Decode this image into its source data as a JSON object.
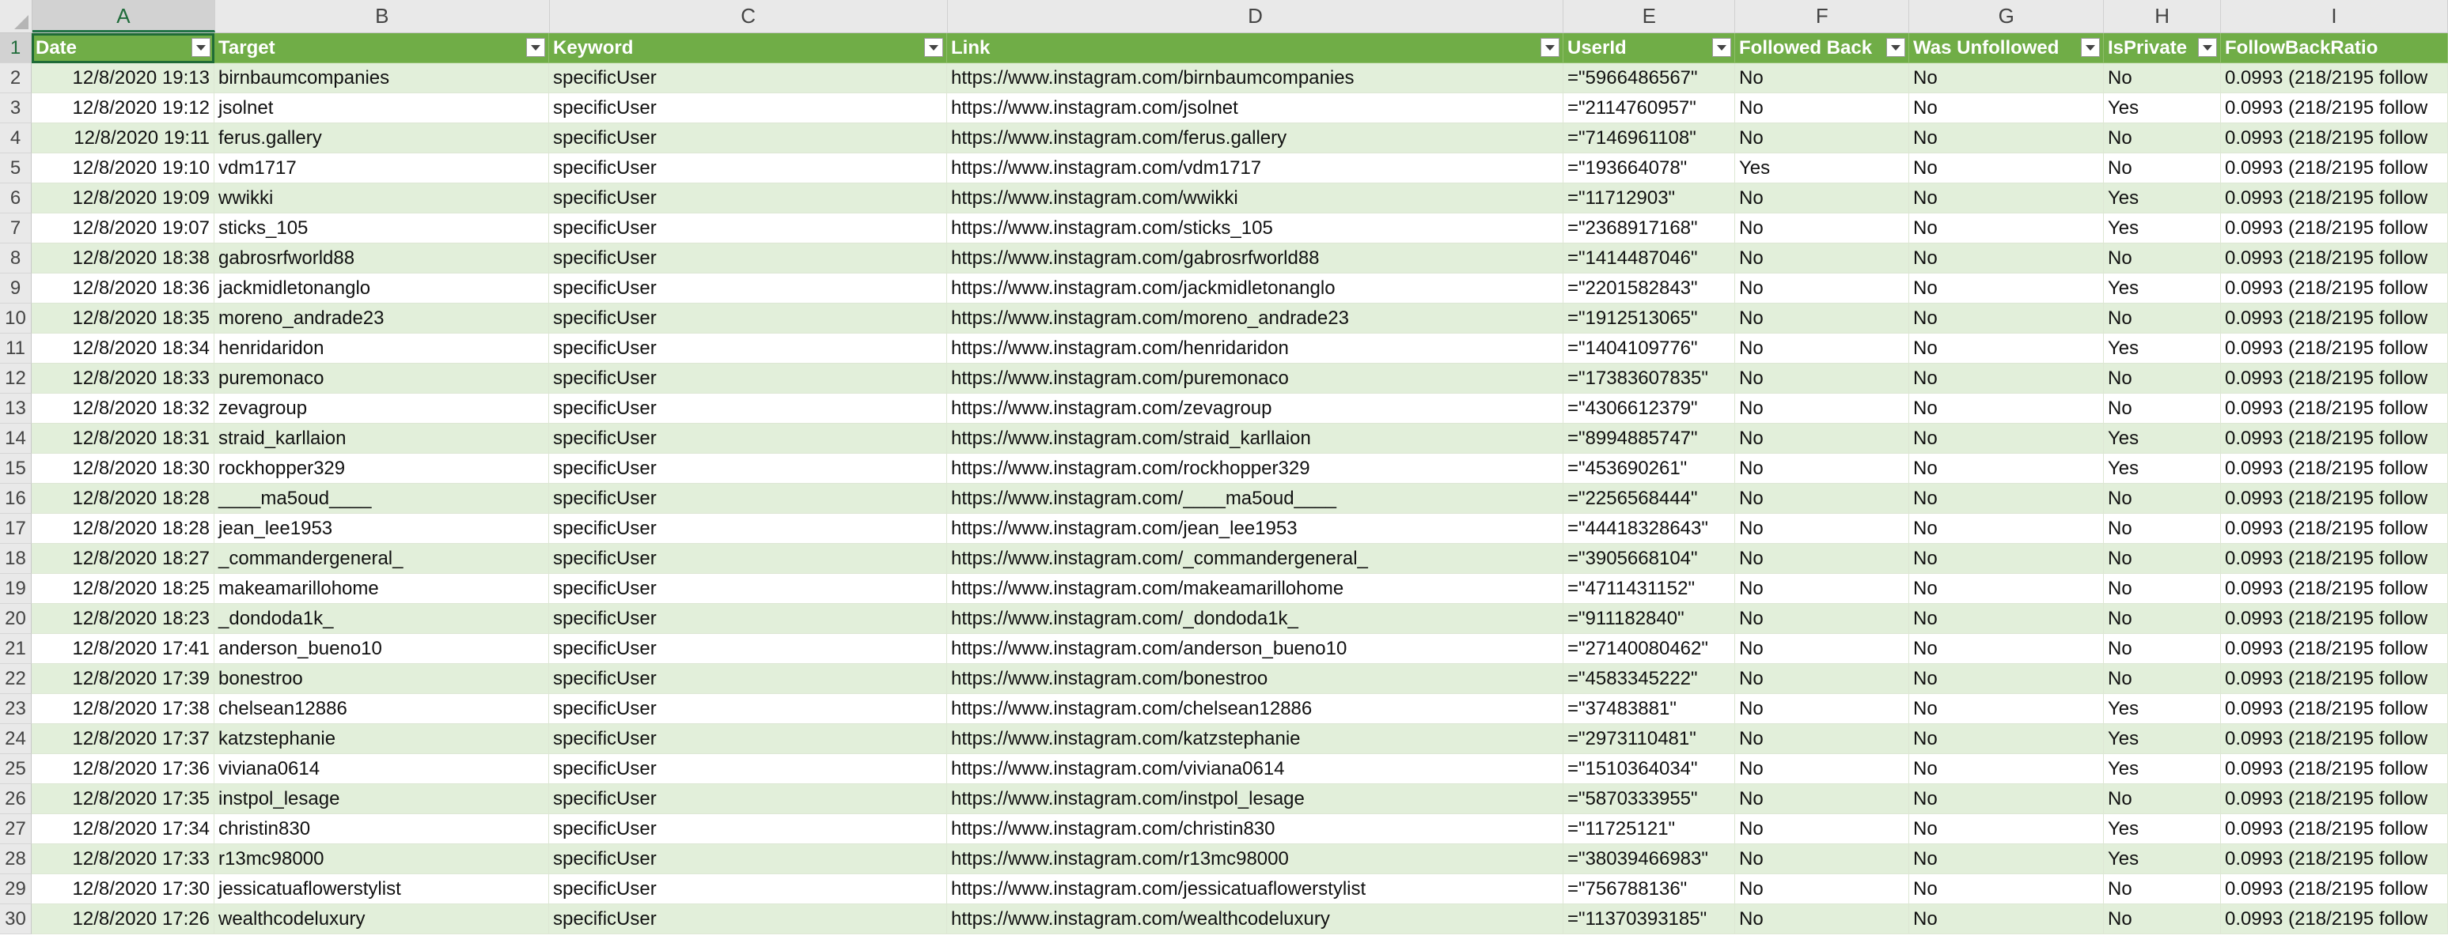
{
  "columns": [
    "A",
    "B",
    "C",
    "D",
    "E",
    "F",
    "G",
    "H",
    "I"
  ],
  "headers": [
    "Date",
    "Target",
    "Keyword",
    "Link",
    "UserId",
    "Followed Back",
    "Was Unfollowed",
    "IsPrivate",
    "FollowBackRatio"
  ],
  "rows": [
    {
      "num": "2",
      "date": "12/8/2020 19:13",
      "target": "birnbaumcompanies",
      "keyword": "specificUser",
      "link": "https://www.instagram.com/birnbaumcompanies",
      "userid": "=\"5966486567\"",
      "followed_back": "No",
      "was_unfollowed": "No",
      "is_private": "No",
      "ratio": "0.0993 (218/2195 follow"
    },
    {
      "num": "3",
      "date": "12/8/2020 19:12",
      "target": "jsolnet",
      "keyword": "specificUser",
      "link": "https://www.instagram.com/jsolnet",
      "userid": "=\"2114760957\"",
      "followed_back": "No",
      "was_unfollowed": "No",
      "is_private": "Yes",
      "ratio": "0.0993 (218/2195 follow"
    },
    {
      "num": "4",
      "date": "12/8/2020 19:11",
      "target": "ferus.gallery",
      "keyword": "specificUser",
      "link": "https://www.instagram.com/ferus.gallery",
      "userid": "=\"7146961108\"",
      "followed_back": "No",
      "was_unfollowed": "No",
      "is_private": "No",
      "ratio": "0.0993 (218/2195 follow"
    },
    {
      "num": "5",
      "date": "12/8/2020 19:10",
      "target": "vdm1717",
      "keyword": "specificUser",
      "link": "https://www.instagram.com/vdm1717",
      "userid": "=\"193664078\"",
      "followed_back": "Yes",
      "was_unfollowed": "No",
      "is_private": "No",
      "ratio": "0.0993 (218/2195 follow"
    },
    {
      "num": "6",
      "date": "12/8/2020 19:09",
      "target": "wwikki",
      "keyword": "specificUser",
      "link": "https://www.instagram.com/wwikki",
      "userid": "=\"11712903\"",
      "followed_back": "No",
      "was_unfollowed": "No",
      "is_private": "Yes",
      "ratio": "0.0993 (218/2195 follow"
    },
    {
      "num": "7",
      "date": "12/8/2020 19:07",
      "target": "sticks_105",
      "keyword": "specificUser",
      "link": "https://www.instagram.com/sticks_105",
      "userid": "=\"2368917168\"",
      "followed_back": "No",
      "was_unfollowed": "No",
      "is_private": "Yes",
      "ratio": "0.0993 (218/2195 follow"
    },
    {
      "num": "8",
      "date": "12/8/2020 18:38",
      "target": "gabrosrfworld88",
      "keyword": "specificUser",
      "link": "https://www.instagram.com/gabrosrfworld88",
      "userid": "=\"1414487046\"",
      "followed_back": "No",
      "was_unfollowed": "No",
      "is_private": "No",
      "ratio": "0.0993 (218/2195 follow"
    },
    {
      "num": "9",
      "date": "12/8/2020 18:36",
      "target": "jackmidletonanglo",
      "keyword": "specificUser",
      "link": "https://www.instagram.com/jackmidletonanglo",
      "userid": "=\"2201582843\"",
      "followed_back": "No",
      "was_unfollowed": "No",
      "is_private": "Yes",
      "ratio": "0.0993 (218/2195 follow"
    },
    {
      "num": "10",
      "date": "12/8/2020 18:35",
      "target": "moreno_andrade23",
      "keyword": "specificUser",
      "link": "https://www.instagram.com/moreno_andrade23",
      "userid": "=\"1912513065\"",
      "followed_back": "No",
      "was_unfollowed": "No",
      "is_private": "No",
      "ratio": "0.0993 (218/2195 follow"
    },
    {
      "num": "11",
      "date": "12/8/2020 18:34",
      "target": "henridaridon",
      "keyword": "specificUser",
      "link": "https://www.instagram.com/henridaridon",
      "userid": "=\"1404109776\"",
      "followed_back": "No",
      "was_unfollowed": "No",
      "is_private": "Yes",
      "ratio": "0.0993 (218/2195 follow"
    },
    {
      "num": "12",
      "date": "12/8/2020 18:33",
      "target": "puremonaco",
      "keyword": "specificUser",
      "link": "https://www.instagram.com/puremonaco",
      "userid": "=\"17383607835\"",
      "followed_back": "No",
      "was_unfollowed": "No",
      "is_private": "No",
      "ratio": "0.0993 (218/2195 follow"
    },
    {
      "num": "13",
      "date": "12/8/2020 18:32",
      "target": "zevagroup",
      "keyword": "specificUser",
      "link": "https://www.instagram.com/zevagroup",
      "userid": "=\"4306612379\"",
      "followed_back": "No",
      "was_unfollowed": "No",
      "is_private": "No",
      "ratio": "0.0993 (218/2195 follow"
    },
    {
      "num": "14",
      "date": "12/8/2020 18:31",
      "target": "straid_karllaion",
      "keyword": "specificUser",
      "link": "https://www.instagram.com/straid_karllaion",
      "userid": "=\"8994885747\"",
      "followed_back": "No",
      "was_unfollowed": "No",
      "is_private": "Yes",
      "ratio": "0.0993 (218/2195 follow"
    },
    {
      "num": "15",
      "date": "12/8/2020 18:30",
      "target": "rockhopper329",
      "keyword": "specificUser",
      "link": "https://www.instagram.com/rockhopper329",
      "userid": "=\"453690261\"",
      "followed_back": "No",
      "was_unfollowed": "No",
      "is_private": "Yes",
      "ratio": "0.0993 (218/2195 follow"
    },
    {
      "num": "16",
      "date": "12/8/2020 18:28",
      "target": "____ma5oud____",
      "keyword": "specificUser",
      "link": "https://www.instagram.com/____ma5oud____",
      "userid": "=\"2256568444\"",
      "followed_back": "No",
      "was_unfollowed": "No",
      "is_private": "No",
      "ratio": "0.0993 (218/2195 follow"
    },
    {
      "num": "17",
      "date": "12/8/2020 18:28",
      "target": "jean_lee1953",
      "keyword": "specificUser",
      "link": "https://www.instagram.com/jean_lee1953",
      "userid": "=\"44418328643\"",
      "followed_back": "No",
      "was_unfollowed": "No",
      "is_private": "No",
      "ratio": "0.0993 (218/2195 follow"
    },
    {
      "num": "18",
      "date": "12/8/2020 18:27",
      "target": "_commandergeneral_",
      "keyword": "specificUser",
      "link": "https://www.instagram.com/_commandergeneral_",
      "userid": "=\"3905668104\"",
      "followed_back": "No",
      "was_unfollowed": "No",
      "is_private": "No",
      "ratio": "0.0993 (218/2195 follow"
    },
    {
      "num": "19",
      "date": "12/8/2020 18:25",
      "target": "makeamarillohome",
      "keyword": "specificUser",
      "link": "https://www.instagram.com/makeamarillohome",
      "userid": "=\"4711431152\"",
      "followed_back": "No",
      "was_unfollowed": "No",
      "is_private": "No",
      "ratio": "0.0993 (218/2195 follow"
    },
    {
      "num": "20",
      "date": "12/8/2020 18:23",
      "target": "_dondoda1k_",
      "keyword": "specificUser",
      "link": "https://www.instagram.com/_dondoda1k_",
      "userid": "=\"911182840\"",
      "followed_back": "No",
      "was_unfollowed": "No",
      "is_private": "No",
      "ratio": "0.0993 (218/2195 follow"
    },
    {
      "num": "21",
      "date": "12/8/2020 17:41",
      "target": "anderson_bueno10",
      "keyword": "specificUser",
      "link": "https://www.instagram.com/anderson_bueno10",
      "userid": "=\"27140080462\"",
      "followed_back": "No",
      "was_unfollowed": "No",
      "is_private": "No",
      "ratio": "0.0993 (218/2195 follow"
    },
    {
      "num": "22",
      "date": "12/8/2020 17:39",
      "target": "bonestroo",
      "keyword": "specificUser",
      "link": "https://www.instagram.com/bonestroo",
      "userid": "=\"4583345222\"",
      "followed_back": "No",
      "was_unfollowed": "No",
      "is_private": "No",
      "ratio": "0.0993 (218/2195 follow"
    },
    {
      "num": "23",
      "date": "12/8/2020 17:38",
      "target": "chelsean12886",
      "keyword": "specificUser",
      "link": "https://www.instagram.com/chelsean12886",
      "userid": "=\"37483881\"",
      "followed_back": "No",
      "was_unfollowed": "No",
      "is_private": "Yes",
      "ratio": "0.0993 (218/2195 follow"
    },
    {
      "num": "24",
      "date": "12/8/2020 17:37",
      "target": "katzstephanie",
      "keyword": "specificUser",
      "link": "https://www.instagram.com/katzstephanie",
      "userid": "=\"2973110481\"",
      "followed_back": "No",
      "was_unfollowed": "No",
      "is_private": "Yes",
      "ratio": "0.0993 (218/2195 follow"
    },
    {
      "num": "25",
      "date": "12/8/2020 17:36",
      "target": "viviana0614",
      "keyword": "specificUser",
      "link": "https://www.instagram.com/viviana0614",
      "userid": "=\"1510364034\"",
      "followed_back": "No",
      "was_unfollowed": "No",
      "is_private": "Yes",
      "ratio": "0.0993 (218/2195 follow"
    },
    {
      "num": "26",
      "date": "12/8/2020 17:35",
      "target": "instpol_lesage",
      "keyword": "specificUser",
      "link": "https://www.instagram.com/instpol_lesage",
      "userid": "=\"5870333955\"",
      "followed_back": "No",
      "was_unfollowed": "No",
      "is_private": "No",
      "ratio": "0.0993 (218/2195 follow"
    },
    {
      "num": "27",
      "date": "12/8/2020 17:34",
      "target": "christin830",
      "keyword": "specificUser",
      "link": "https://www.instagram.com/christin830",
      "userid": "=\"11725121\"",
      "followed_back": "No",
      "was_unfollowed": "No",
      "is_private": "Yes",
      "ratio": "0.0993 (218/2195 follow"
    },
    {
      "num": "28",
      "date": "12/8/2020 17:33",
      "target": "r13mc98000",
      "keyword": "specificUser",
      "link": "https://www.instagram.com/r13mc98000",
      "userid": "=\"38039466983\"",
      "followed_back": "No",
      "was_unfollowed": "No",
      "is_private": "Yes",
      "ratio": "0.0993 (218/2195 follow"
    },
    {
      "num": "29",
      "date": "12/8/2020 17:30",
      "target": "jessicatuaflowerstylist",
      "keyword": "specificUser",
      "link": "https://www.instagram.com/jessicatuaflowerstylist",
      "userid": "=\"756788136\"",
      "followed_back": "No",
      "was_unfollowed": "No",
      "is_private": "No",
      "ratio": "0.0993 (218/2195 follow"
    },
    {
      "num": "30",
      "date": "12/8/2020 17:26",
      "target": "wealthcodeluxury",
      "keyword": "specificUser",
      "link": "https://www.instagram.com/wealthcodeluxury",
      "userid": "=\"11370393185\"",
      "followed_back": "No",
      "was_unfollowed": "No",
      "is_private": "No",
      "ratio": "0.0993 (218/2195 follow"
    }
  ],
  "header_row_num": "1",
  "colors": {
    "header_green": "#70ad47",
    "band_green": "#e2efda",
    "accent": "#217346"
  },
  "icons": {
    "filter": "filter-dropdown-icon"
  }
}
